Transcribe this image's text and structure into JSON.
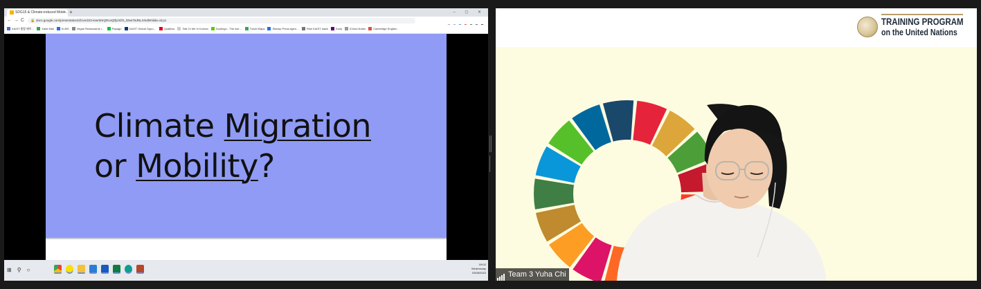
{
  "browser": {
    "tab_title": "SDG15 & Climate-induced Mobi…",
    "tab_close": "×",
    "new_tab": "+",
    "window_controls": "–  ◻  ✕",
    "nav_back": "←",
    "nav_forward": "→",
    "nav_reload": "C",
    "url": "docs.google.com/presentation/d/1vndJCHnwrMXQRuvQtfy2GfS_D8wT5dNLX/edit#slide=id.p1",
    "bookmarks": [
      "KAIST 통합 메이…",
      "Kaist Mail",
      "KLMS",
      "Vegan Restaurants i…",
      "Papago",
      "KAIST Global Oppo…",
      "Qualtrics",
      "Talk To Me In Korean",
      "Duolingo - The wor…",
      "Travel Maps",
      "Startup Press Agen…",
      "Rise KAIST stack",
      "Kurly",
      "iCloud Notes",
      "Cambridge English…"
    ]
  },
  "slide": {
    "line1_plain": "Climate ",
    "line1_underlined": "Migration",
    "line2_plain": "or ",
    "line2_underlined": "Mobility",
    "line2_end": "?",
    "bg_color": "#8f9bf4"
  },
  "taskbar": {
    "start_icon": "⊞",
    "search_icon": "⚲",
    "taskview_icon": "○",
    "time": "09:02",
    "day": "Wednesday",
    "date": "03/08/2022"
  },
  "video": {
    "logo_line1": "TRAINING PROGRAM",
    "logo_line2": "on the United Nations",
    "participant_name": "Team 3 Yuha Chi"
  },
  "sdg_colors": [
    "#e5243b",
    "#dda63a",
    "#4c9f38",
    "#c5192d",
    "#ff3a21",
    "#26bde2",
    "#fcc30b",
    "#a21942",
    "#fd6925",
    "#dd1367",
    "#fd9d24",
    "#bf8b2e",
    "#3f7e44",
    "#0a97d9",
    "#56c02b",
    "#00689d",
    "#19486a"
  ]
}
